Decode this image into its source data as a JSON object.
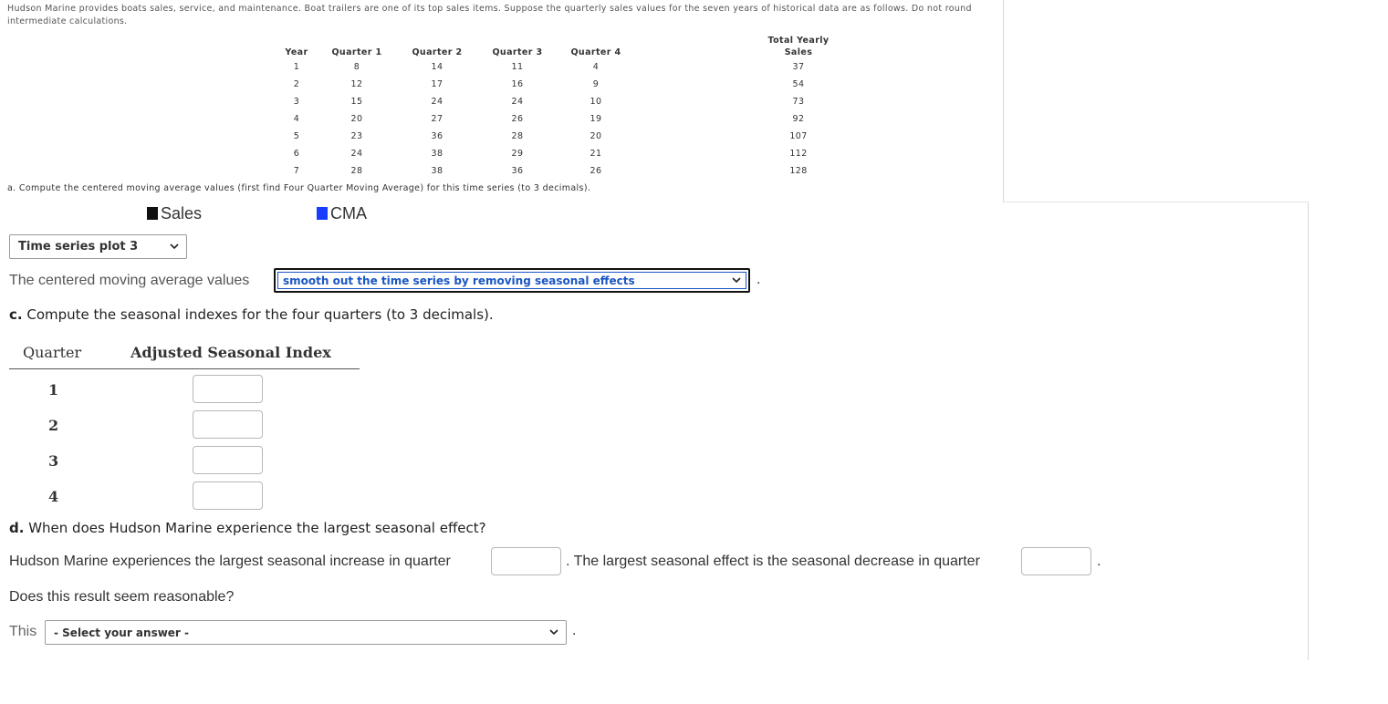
{
  "intro_text": "Hudson Marine provides boats sales, service, and maintenance. Boat trailers are one of its top sales items. Suppose the quarterly sales values for the seven years of historical data are as follows. Do not round intermediate calculations.",
  "table": {
    "headers": {
      "year": "Year",
      "q1": "Quarter 1",
      "q2": "Quarter 2",
      "q3": "Quarter 3",
      "q4": "Quarter 4",
      "total_line1": "Total Yearly",
      "total_line2": "Sales"
    },
    "rows": [
      {
        "year": "1",
        "q1": "8",
        "q2": "14",
        "q3": "11",
        "q4": "4",
        "total": "37"
      },
      {
        "year": "2",
        "q1": "12",
        "q2": "17",
        "q3": "16",
        "q4": "9",
        "total": "54"
      },
      {
        "year": "3",
        "q1": "15",
        "q2": "24",
        "q3": "24",
        "q4": "10",
        "total": "73"
      },
      {
        "year": "4",
        "q1": "20",
        "q2": "27",
        "q3": "26",
        "q4": "19",
        "total": "92"
      },
      {
        "year": "5",
        "q1": "23",
        "q2": "36",
        "q3": "28",
        "q4": "20",
        "total": "107"
      },
      {
        "year": "6",
        "q1": "24",
        "q2": "38",
        "q3": "29",
        "q4": "21",
        "total": "112"
      },
      {
        "year": "7",
        "q1": "28",
        "q2": "38",
        "q3": "36",
        "q4": "26",
        "total": "128"
      }
    ]
  },
  "part_a_text": "a. Compute the centered moving average values (first find Four Quarter Moving Average) for this time series (to 3 decimals).",
  "legend": {
    "sales_label": "Sales",
    "sales_color": "#111111",
    "cma_label": "CMA",
    "cma_color": "#1a3cff"
  },
  "plot_select_value": "Time series plot 3",
  "cma_sentence_prefix": "The centered moving average values",
  "cma_select_value": "smooth out the time series by removing seasonal effects",
  "cma_sentence_suffix": ".",
  "part_c": {
    "letter": "c.",
    "text": " Compute the seasonal indexes for the four quarters (to 3 decimals)."
  },
  "index_table": {
    "col_quarter": "Quarter",
    "col_index": "Adjusted Seasonal Index",
    "quarters": [
      "1",
      "2",
      "3",
      "4"
    ]
  },
  "part_d": {
    "letter": "d.",
    "text": " When does Hudson Marine experience the largest seasonal effect?"
  },
  "increase_sentence": {
    "prefix": "Hudson Marine experiences the largest seasonal increase in quarter",
    "middle": ". The largest seasonal effect is the seasonal decrease in quarter",
    "suffix": "."
  },
  "reasonable_question": "Does this result seem reasonable?",
  "this_label": "This",
  "answer_select_value": "- Select your answer -",
  "answer_suffix": "."
}
